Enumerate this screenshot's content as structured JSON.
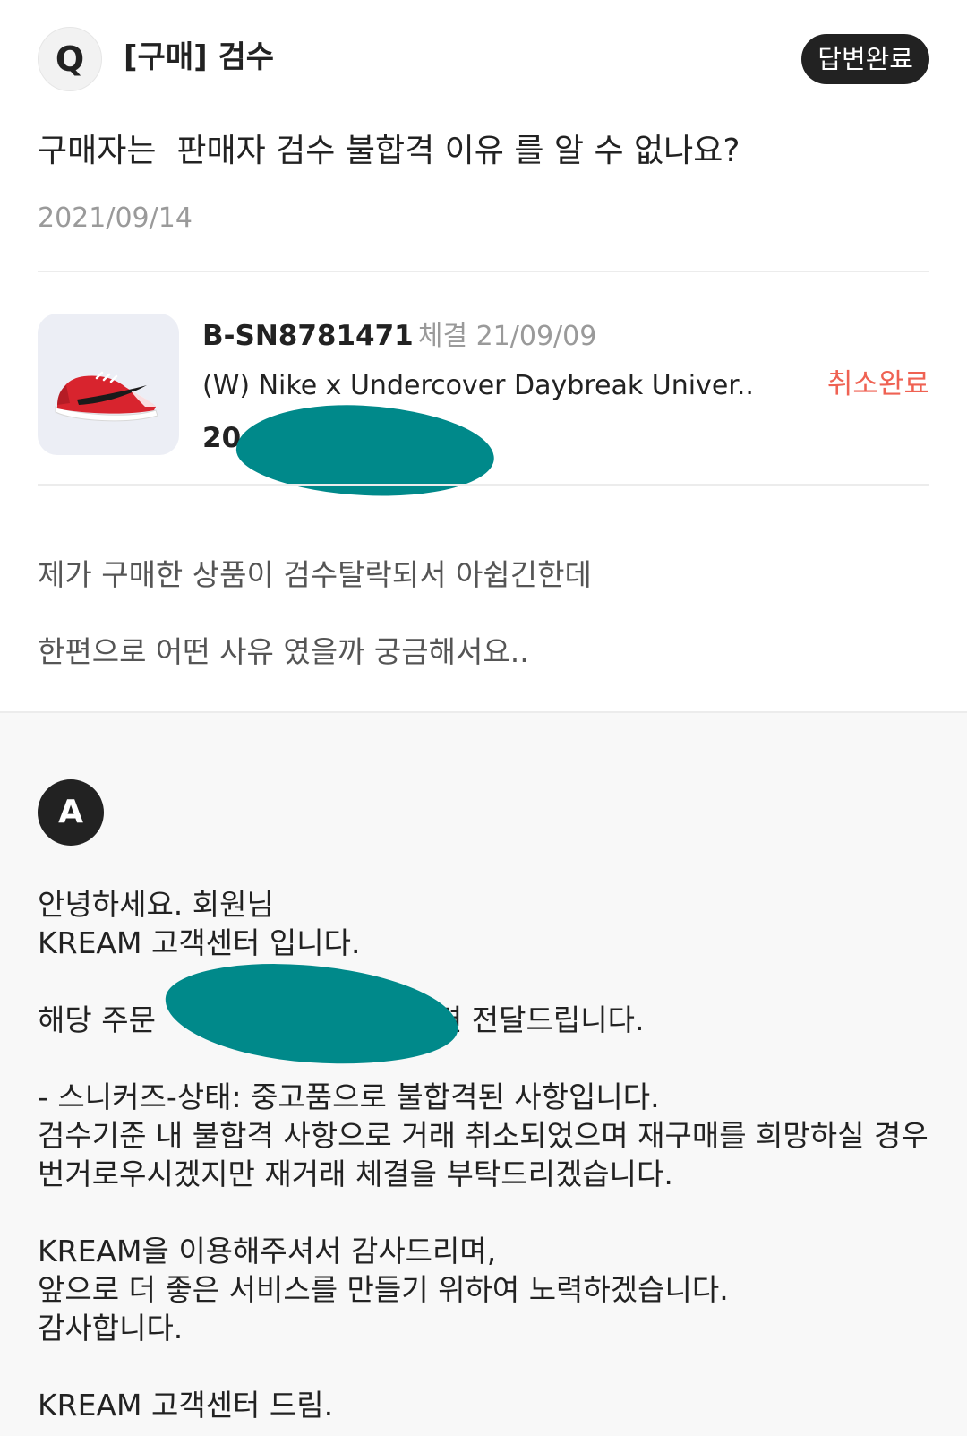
{
  "question": {
    "badge": "Q",
    "category": "[구매] 검수",
    "status": "답변완료",
    "title": "구매자는  판매자 검수 불합격 이유 를 알 수 없나요?",
    "date": "2021/09/14",
    "body": [
      "제가 구매한 상품이 검수탈락되서 아쉽긴한데",
      "한편으로 어떤 사유 였을까 궁금해서요.."
    ]
  },
  "order": {
    "number": "B-SN8781471",
    "meta": "체결 21/09/09",
    "product_name": "(W) Nike x Undercover Daybreak Univer...",
    "status": "취소완료",
    "price_visible": "20",
    "thumbnail_icon": "red-sneaker-image"
  },
  "answer": {
    "badge": "A",
    "greeting": "안녕하세요. 회원님",
    "intro": "KREAM 고객센터 입니다.",
    "order_line_start": "해당 주문",
    "order_line_end": "련 전달드립니다.",
    "reason_1": "- 스니커즈-상태: 중고품으로 불합격된 사항입니다.",
    "reason_2": "검수기준 내 불합격 사항으로 거래 취소되었으며 재구매를 희망하실 경우",
    "reason_3": "번거로우시겠지만 재거래 체결을 부탁드리겠습니다.",
    "thanks_1": "KREAM을 이용해주셔서 감사드리며,",
    "thanks_2": "앞으로 더 좋은 서비스를 만들기 위하여 노력하겠습니다.",
    "thanks_3": "감사합니다.",
    "signature": "KREAM 고객센터 드림."
  },
  "colors": {
    "accent_dark": "#222222",
    "cancel_red": "#ef6253",
    "muted_gray": "#9a9a9a",
    "redaction_teal": "#00898a",
    "answer_bg": "#f8f8f8"
  }
}
